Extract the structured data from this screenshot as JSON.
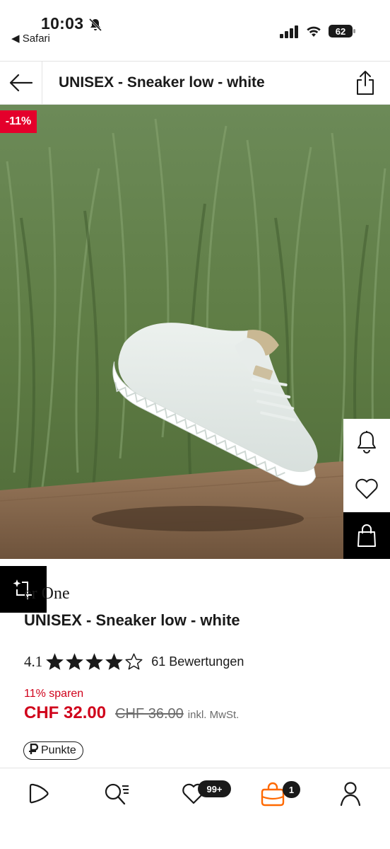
{
  "status_bar": {
    "time": "10:03",
    "back_app": "◀ Safari",
    "battery": "62"
  },
  "header": {
    "title": "UNISEX - Sneaker low - white"
  },
  "product": {
    "discount_badge": "-11%",
    "brand": "er One",
    "title": "UNISEX - Sneaker low - white",
    "rating": "4.1",
    "stars_filled": 4,
    "stars_total": 5,
    "reviews": "61 Bewertungen",
    "save_text": "11% sparen",
    "price": "CHF 32.00",
    "old_price": "CHF 36.00",
    "tax_note": "inkl. MwSt.",
    "points_label": "Punkte",
    "points_icon": "P"
  },
  "side_actions": {
    "icons": [
      "bell-icon",
      "heart-icon",
      "bag-icon"
    ]
  },
  "tabbar": {
    "wishlist_badge": "99+",
    "cart_badge": "1",
    "icons": [
      "home-icon",
      "search-icon",
      "wishlist-icon",
      "cart-icon",
      "account-icon"
    ],
    "accent_color": "#ff6900"
  },
  "colors": {
    "sale_red": "#d0021b",
    "badge_red": "#e4002b",
    "text": "#1a1a1a"
  }
}
